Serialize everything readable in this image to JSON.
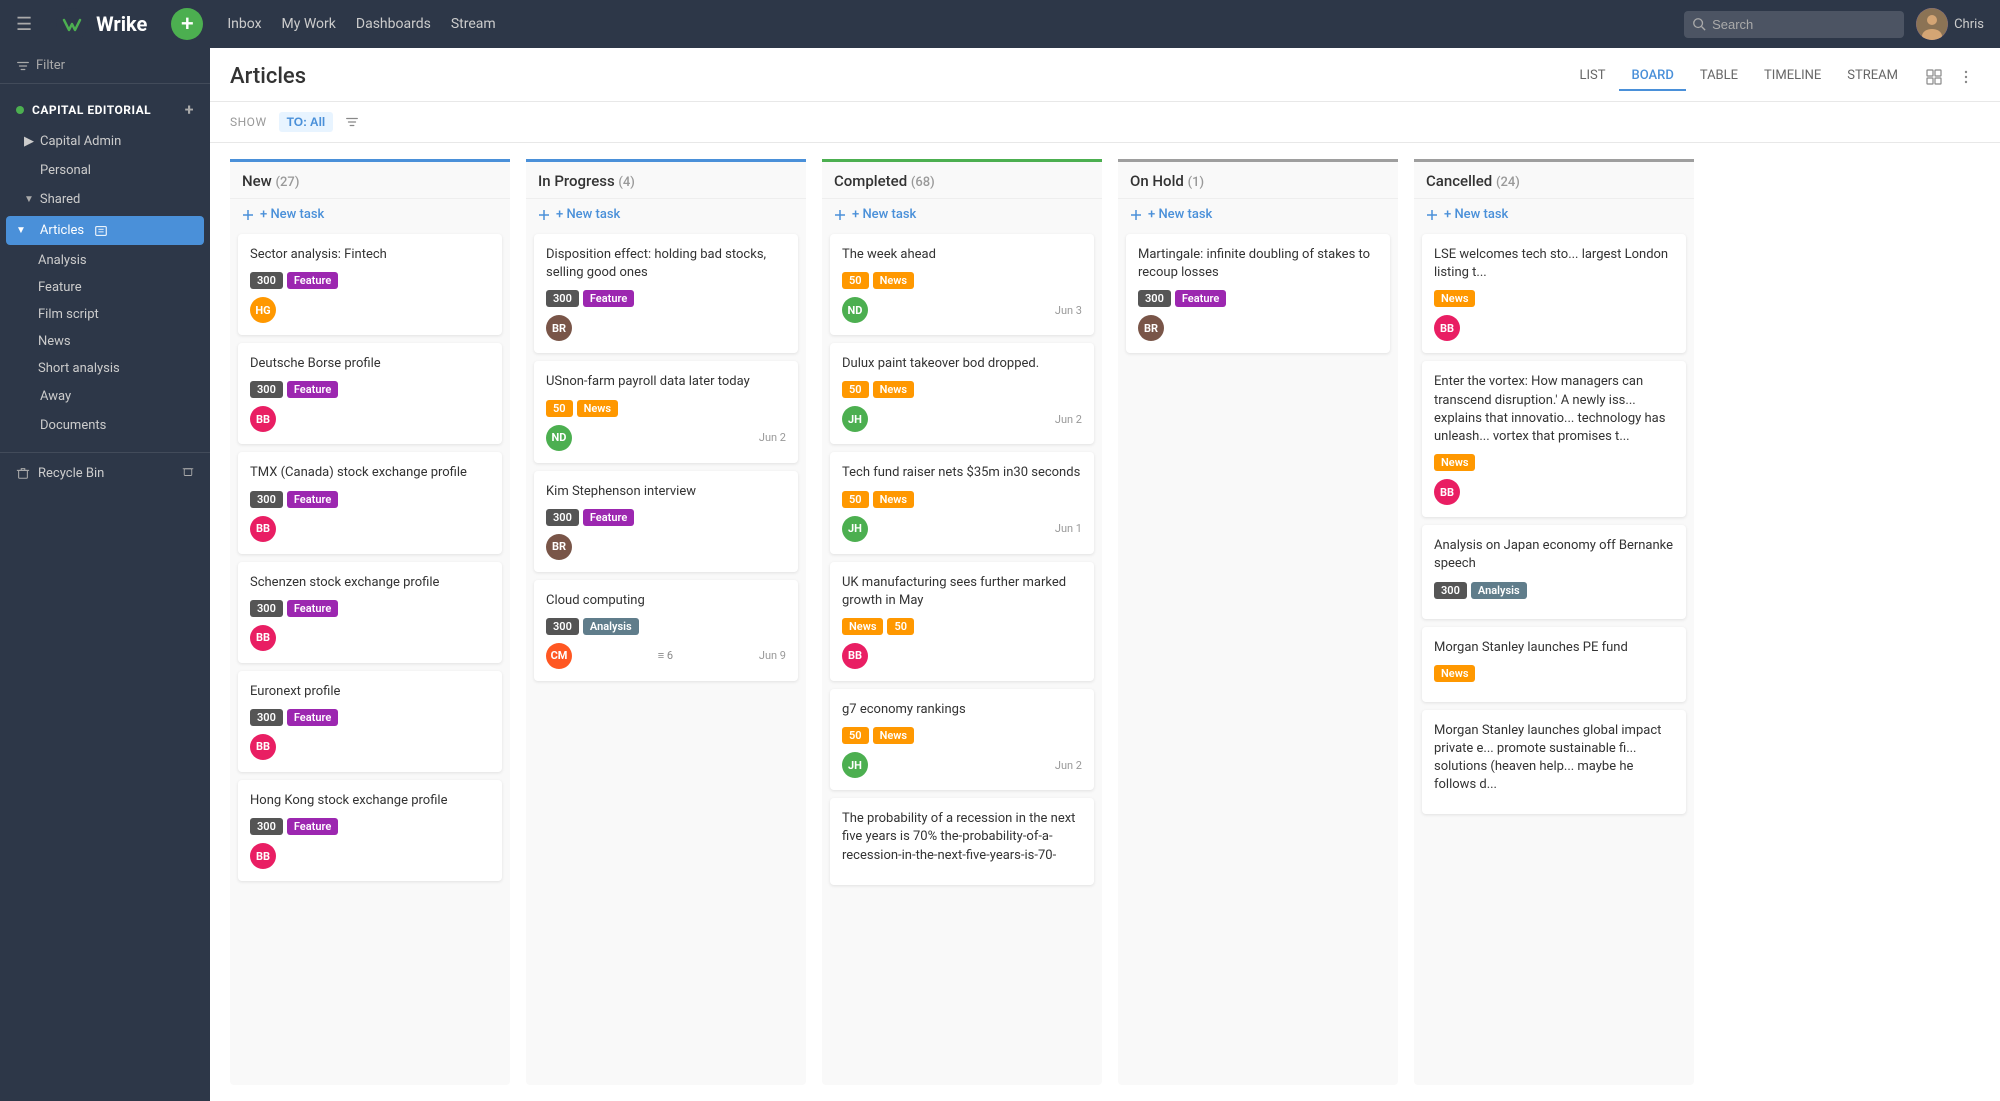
{
  "topnav": {
    "logo": "Wrike",
    "add_label": "+",
    "links": [
      "Inbox",
      "My Work",
      "Dashboards",
      "Stream"
    ],
    "search_placeholder": "Search",
    "user_name": "Chris"
  },
  "sidebar": {
    "filter_label": "Filter",
    "section_capital": "CAPITAL EDITORIAL",
    "items": [
      {
        "label": "Capital Admin",
        "indent": 1
      },
      {
        "label": "Personal",
        "indent": 1
      },
      {
        "label": "Shared",
        "indent": 1,
        "expanded": true
      },
      {
        "label": "Articles",
        "indent": 2,
        "active": true
      },
      {
        "label": "Analysis",
        "indent": 3
      },
      {
        "label": "Feature",
        "indent": 3
      },
      {
        "label": "Film script",
        "indent": 3
      },
      {
        "label": "News",
        "indent": 3
      },
      {
        "label": "Short analysis",
        "indent": 3
      },
      {
        "label": "Away",
        "indent": 2
      },
      {
        "label": "Documents",
        "indent": 2
      }
    ],
    "recycle_bin": "Recycle Bin"
  },
  "content": {
    "title": "Articles",
    "show_label": "SHOW",
    "to_all": "TO: All",
    "view_tabs": [
      "LIST",
      "BOARD",
      "TABLE",
      "TIMELINE",
      "STREAM"
    ],
    "active_tab": "BOARD"
  },
  "columns": [
    {
      "id": "new",
      "title": "New",
      "count": "27",
      "color": "new-col",
      "new_task_label": "+ New task",
      "cards": [
        {
          "title": "Sector analysis: Fintech",
          "tags": [
            {
              "text": "300",
              "class": "tag-300"
            },
            {
              "text": "Feature",
              "class": "tag-feature"
            }
          ],
          "avatar": {
            "initials": "HG",
            "class": "avatar-hg"
          },
          "date": ""
        },
        {
          "title": "Deutsche Borse profile",
          "tags": [
            {
              "text": "300",
              "class": "tag-300"
            },
            {
              "text": "Feature",
              "class": "tag-feature"
            }
          ],
          "avatar": {
            "initials": "BB",
            "class": "avatar-bb"
          },
          "date": ""
        },
        {
          "title": "TMX (Canada) stock exchange profile",
          "tags": [
            {
              "text": "300",
              "class": "tag-300"
            },
            {
              "text": "Feature",
              "class": "tag-feature"
            }
          ],
          "avatar": {
            "initials": "BB",
            "class": "avatar-bb"
          },
          "date": ""
        },
        {
          "title": "Schenzen stock exchange profile",
          "tags": [
            {
              "text": "300",
              "class": "tag-300"
            },
            {
              "text": "Feature",
              "class": "tag-feature"
            }
          ],
          "avatar": {
            "initials": "BB",
            "class": "avatar-bb"
          },
          "date": ""
        },
        {
          "title": "Euronext profile",
          "tags": [
            {
              "text": "300",
              "class": "tag-300"
            },
            {
              "text": "Feature",
              "class": "tag-feature"
            }
          ],
          "avatar": {
            "initials": "BB",
            "class": "avatar-bb"
          },
          "date": ""
        },
        {
          "title": "Hong Kong stock exchange profile",
          "tags": [
            {
              "text": "300",
              "class": "tag-300"
            },
            {
              "text": "Feature",
              "class": "tag-feature"
            }
          ],
          "avatar": {
            "initials": "BB",
            "class": "avatar-bb"
          },
          "date": ""
        }
      ]
    },
    {
      "id": "in-progress",
      "title": "In Progress",
      "count": "4",
      "color": "in-progress-col",
      "new_task_label": "+ New task",
      "cards": [
        {
          "title": "Disposition effect: holding bad stocks, selling good ones",
          "tags": [
            {
              "text": "300",
              "class": "tag-300"
            },
            {
              "text": "Feature",
              "class": "tag-feature"
            }
          ],
          "avatar": {
            "initials": "BR",
            "class": "avatar-brown"
          },
          "date": ""
        },
        {
          "title": "USnon-farm payroll data later today",
          "tags": [
            {
              "text": "50",
              "class": "tag-50"
            },
            {
              "text": "News",
              "class": "tag-news"
            }
          ],
          "avatar": {
            "initials": "ND",
            "class": "avatar-nd"
          },
          "date": "Jun 2"
        },
        {
          "title": "Kim Stephenson interview",
          "tags": [
            {
              "text": "300",
              "class": "tag-300"
            },
            {
              "text": "Feature",
              "class": "tag-feature"
            }
          ],
          "avatar": {
            "initials": "BR",
            "class": "avatar-brown"
          },
          "date": ""
        },
        {
          "title": "Cloud computing",
          "tags": [
            {
              "text": "300",
              "class": "tag-300"
            },
            {
              "text": "Analysis",
              "class": "tag-analysis"
            }
          ],
          "avatar": {
            "initials": "CM",
            "class": "avatar-cm"
          },
          "date": "Jun 9",
          "subtasks": "6"
        }
      ]
    },
    {
      "id": "completed",
      "title": "Completed",
      "count": "68",
      "color": "completed-col",
      "new_task_label": "+ New task",
      "cards": [
        {
          "title": "The week ahead",
          "tags": [
            {
              "text": "50",
              "class": "tag-50"
            },
            {
              "text": "News",
              "class": "tag-news"
            }
          ],
          "avatar": {
            "initials": "ND",
            "class": "avatar-nd"
          },
          "date": "Jun 3"
        },
        {
          "title": "Dulux paint takeover bod dropped.",
          "tags": [
            {
              "text": "50",
              "class": "tag-50"
            },
            {
              "text": "News",
              "class": "tag-news"
            }
          ],
          "avatar": {
            "initials": "JH",
            "class": "avatar-jh"
          },
          "date": "Jun 2"
        },
        {
          "title": "Tech fund raiser nets $35m in30 seconds",
          "tags": [
            {
              "text": "50",
              "class": "tag-50"
            },
            {
              "text": "News",
              "class": "tag-news"
            }
          ],
          "avatar": {
            "initials": "JH",
            "class": "avatar-jh"
          },
          "date": "Jun 1"
        },
        {
          "title": "UK manufacturing sees further marked growth in May",
          "tags": [
            {
              "text": "News",
              "class": "tag-news"
            },
            {
              "text": "50",
              "class": "tag-50"
            }
          ],
          "avatar": {
            "initials": "BB",
            "class": "avatar-bb"
          },
          "date": ""
        },
        {
          "title": "g7 economy rankings",
          "tags": [
            {
              "text": "50",
              "class": "tag-50"
            },
            {
              "text": "News",
              "class": "tag-news"
            }
          ],
          "avatar": {
            "initials": "JH",
            "class": "avatar-jh"
          },
          "date": "Jun 2"
        },
        {
          "title": "The probability of a recession in the next five years is 70% the-probability-of-a-recession-in-the-next-five-years-is-70-",
          "tags": [],
          "avatar": null,
          "date": ""
        }
      ]
    },
    {
      "id": "on-hold",
      "title": "On Hold",
      "count": "1",
      "color": "on-hold-col",
      "new_task_label": "+ New task",
      "cards": [
        {
          "title": "Martingale: infinite doubling of stakes to recoup losses",
          "tags": [
            {
              "text": "300",
              "class": "tag-300"
            },
            {
              "text": "Feature",
              "class": "tag-feature"
            }
          ],
          "avatar": {
            "initials": "BR",
            "class": "avatar-brown"
          },
          "date": ""
        }
      ]
    },
    {
      "id": "cancelled",
      "title": "Cancelled",
      "count": "24",
      "color": "cancelled-col",
      "new_task_label": "+ New task",
      "cards": [
        {
          "title": "LSE welcomes tech sto... largest London listing t...",
          "tags": [
            {
              "text": "News",
              "class": "tag-news"
            }
          ],
          "avatar": {
            "initials": "BB",
            "class": "avatar-bb"
          },
          "date": ""
        },
        {
          "title": "Enter the vortex: How managers can transcend disruption.' A newly iss... explains that innovatio... technology has unleash... vortex that promises t...",
          "tags": [
            {
              "text": "News",
              "class": "tag-news"
            }
          ],
          "avatar": {
            "initials": "BB",
            "class": "avatar-bb"
          },
          "date": ""
        },
        {
          "title": "Analysis on Japan economy off Bernanke speech",
          "tags": [
            {
              "text": "300",
              "class": "tag-300"
            },
            {
              "text": "Analysis",
              "class": "tag-analysis"
            }
          ],
          "avatar": null,
          "date": ""
        },
        {
          "title": "Morgan Stanley launches PE fund",
          "tags": [
            {
              "text": "News",
              "class": "tag-news"
            }
          ],
          "avatar": null,
          "date": ""
        },
        {
          "title": "Morgan Stanley launches global impact private e... promote sustainable fi... solutions (heaven help... maybe he follows d...",
          "tags": [],
          "avatar": null,
          "date": ""
        }
      ]
    }
  ]
}
